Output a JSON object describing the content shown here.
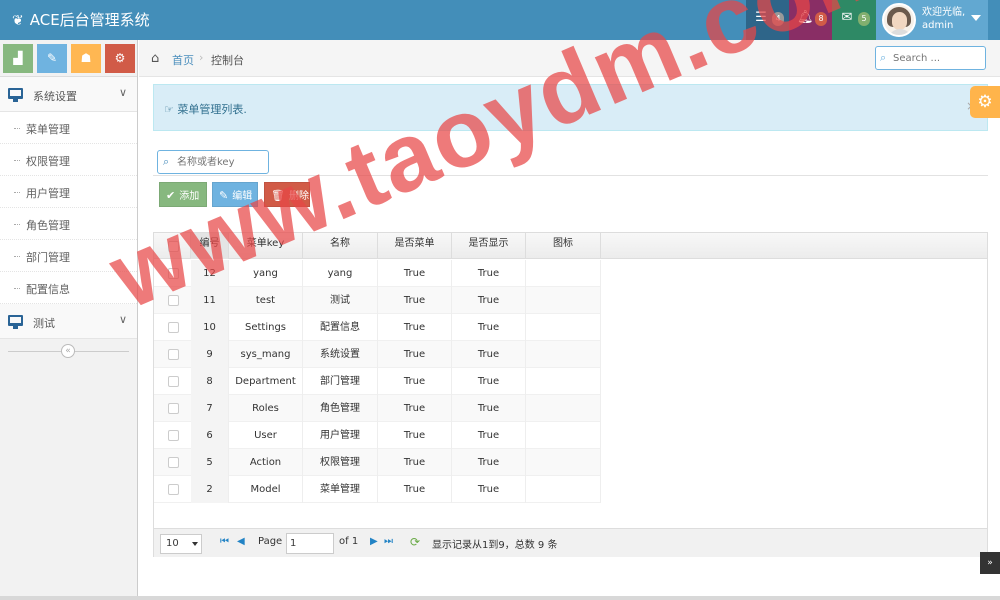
{
  "app": {
    "title": "ACE后台管理系统"
  },
  "header": {
    "badges": {
      "tasks": "4",
      "notifications": "8",
      "messages": "5"
    },
    "user": {
      "welcome": "欢迎光临,",
      "name": "admin"
    }
  },
  "sidebar": {
    "groups": [
      {
        "label": "系统设置",
        "items": [
          "菜单管理",
          "权限管理",
          "用户管理",
          "角色管理",
          "部门管理",
          "配置信息"
        ]
      },
      {
        "label": "测试"
      }
    ]
  },
  "breadcrumb": {
    "home": "首页",
    "current": "控制台"
  },
  "search": {
    "placeholder": "Search ..."
  },
  "alert": {
    "text": "菜单管理列表."
  },
  "filter": {
    "placeholder": "名称或者key"
  },
  "actions": {
    "add": "添加",
    "edit": "编辑",
    "delete": "删除"
  },
  "table": {
    "columns": [
      "编号",
      "菜单key",
      "名称",
      "是否菜单",
      "是否显示",
      "图标"
    ],
    "rows": [
      [
        "12",
        "yang",
        "yang",
        "True",
        "True",
        ""
      ],
      [
        "11",
        "test",
        "测试",
        "True",
        "True",
        ""
      ],
      [
        "10",
        "Settings",
        "配置信息",
        "True",
        "True",
        ""
      ],
      [
        "9",
        "sys_mang",
        "系统设置",
        "True",
        "True",
        ""
      ],
      [
        "8",
        "Department",
        "部门管理",
        "True",
        "True",
        ""
      ],
      [
        "7",
        "Roles",
        "角色管理",
        "True",
        "True",
        ""
      ],
      [
        "6",
        "User",
        "用户管理",
        "True",
        "True",
        ""
      ],
      [
        "5",
        "Action",
        "权限管理",
        "True",
        "True",
        ""
      ],
      [
        "2",
        "Model",
        "菜单管理",
        "True",
        "True",
        ""
      ]
    ]
  },
  "pager": {
    "page_size": "10",
    "page_label": "Page",
    "page_value": "1",
    "of_label": "of 1",
    "records": "显示记录从1到9，总数 9 条"
  },
  "watermark": "www.taoydm.com",
  "colors": {
    "navbar": "#438eb9",
    "add": "#87b87f",
    "edit": "#6fb3e0",
    "delete": "#d15b47"
  }
}
